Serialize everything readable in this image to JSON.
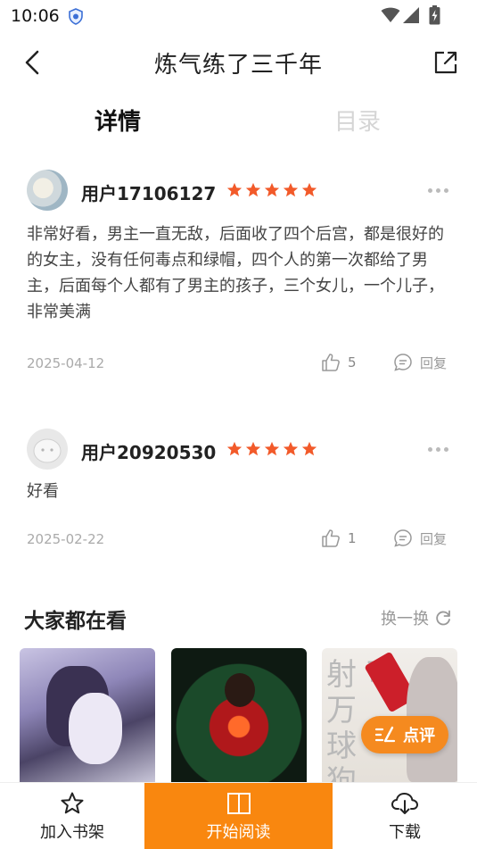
{
  "status_bar": {
    "time": "10:06"
  },
  "header": {
    "title": "炼气练了三千年"
  },
  "tabs": [
    {
      "label": "详情",
      "active": true
    },
    {
      "label": "目录",
      "active": false
    }
  ],
  "comments": [
    {
      "username": "用户17106127",
      "rating": 5,
      "text": "非常好看，男主一直无敌，后面收了四个后宫，都是很好的的女主，没有任何毒点和绿帽，四个人的第一次都给了男主，后面每个人都有了男主的孩子，三个女儿，一个儿子，非常美满",
      "date": "2025-04-12",
      "likes": "5",
      "reply_label": "回复"
    },
    {
      "username": "用户20920530",
      "rating": 5,
      "text": "好看",
      "date": "2025-02-22",
      "likes": "1",
      "reply_label": "回复"
    }
  ],
  "recommend": {
    "title": "大家都在看",
    "refresh_label": "换一换",
    "covers": [
      {
        "icon": "cover-image"
      },
      {
        "icon": "cover-image"
      },
      {
        "icon": "cover-image",
        "partial_text": "射 可\n万\n球\n狗"
      }
    ]
  },
  "review_button": {
    "label": "点评"
  },
  "bottom_bar": {
    "shelf_label": "加入书架",
    "read_label": "开始阅读",
    "download_label": "下载"
  },
  "colors": {
    "accent": "#f9870f",
    "star": "#f25a2a"
  }
}
